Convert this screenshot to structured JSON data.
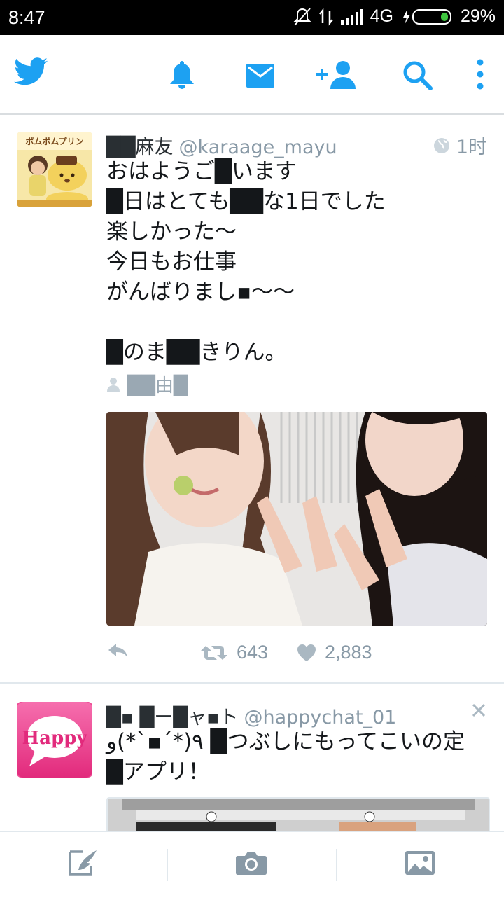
{
  "status_bar": {
    "time": "8:47",
    "network": "4G",
    "battery": "29%"
  },
  "top_nav": {
    "icons": [
      "twitter-bird-icon",
      "notifications-bell-icon",
      "messages-envelope-icon",
      "add-user-icon",
      "search-icon",
      "overflow-menu-icon"
    ]
  },
  "tweets": [
    {
      "name": "██麻友",
      "handle": "@karaage_mayu",
      "time": "1时",
      "lines": [
        "おはようご█います",
        "█日はとても██な1日でした",
        "楽しかった〜",
        "今日もお仕事",
        "がんばりまし▪〜〜",
        "",
        "█のま██きりん。"
      ],
      "location": "██由█",
      "replies_label": "",
      "retweets": "643",
      "likes": "2,883"
    },
    {
      "name": "█▪ █ー█ャ▪ト",
      "handle": "@happychat_01",
      "lines": [
        "٩(*´▪`*)و █つぶしにもってこいの定",
        "█アプリ！"
      ],
      "avatar_text": "Happy"
    }
  ],
  "bottom_bar": {
    "icons": [
      "compose-tweet-icon",
      "camera-icon",
      "gallery-icon"
    ]
  },
  "colors": {
    "accent": "#1da1f2",
    "muted": "#8899a6",
    "divider": "#e1e8ed"
  }
}
